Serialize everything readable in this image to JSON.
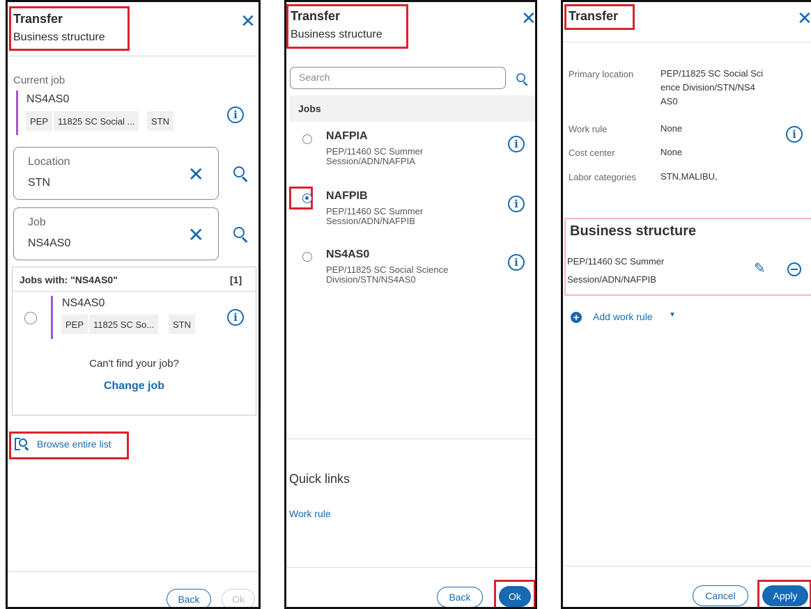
{
  "panel1": {
    "title": "Transfer",
    "subtitle": "Business structure",
    "current_job_label": "Current job",
    "current_job": {
      "name": "NS4AS0",
      "tags": [
        "PEP",
        "11825 SC Social ...",
        "STN"
      ]
    },
    "location_field": {
      "label": "Location",
      "value": "STN"
    },
    "job_field": {
      "label": "Job",
      "value": "NS4AS0"
    },
    "results_header": "Jobs with: \"NS4AS0\"",
    "results_count": "[1]",
    "result": {
      "name": "NS4AS0",
      "tags": [
        "PEP",
        "11825 SC So...",
        "STN"
      ]
    },
    "cant_find": "Can't find your job?",
    "change_job": "Change job",
    "browse_link": "Browse entire list",
    "back_button": "Back",
    "ok_button": "Ok"
  },
  "panel2": {
    "title": "Transfer",
    "subtitle": "Business structure",
    "search_placeholder": "Search",
    "jobs_header": "Jobs",
    "jobs": [
      {
        "name": "NAFPIA",
        "path_line1": "PEP/11460 SC Summer",
        "path_line2": "Session/ADN/NAFPIA",
        "selected": false
      },
      {
        "name": "NAFPIB",
        "path_line1": "PEP/11460 SC Summer",
        "path_line2": "Session/ADN/NAFPIB",
        "selected": true
      },
      {
        "name": "NS4AS0",
        "path_line1": "PEP/11825 SC Social Science",
        "path_line2": "Division/STN/NS4AS0",
        "selected": false
      }
    ],
    "quick_links_title": "Quick links",
    "quick_link": "Work rule",
    "back_button": "Back",
    "ok_button": "Ok"
  },
  "panel3": {
    "title": "Transfer",
    "primary_location_label": "Primary location",
    "primary_location_line1": "PEP/11825 SC Social Sci",
    "primary_location_line2": "ence Division/STN/NS4",
    "primary_location_line3": "AS0",
    "work_rule_label": "Work rule",
    "work_rule_value": "None",
    "cost_center_label": "Cost center",
    "cost_center_value": "None",
    "labor_categories_label": "Labor categories",
    "labor_categories_value": "STN,MALIBU,",
    "business_structure_title": "Business structure",
    "business_structure_line1": "PEP/11460 SC Summer",
    "business_structure_line2": "Session/ADN/NAFPIB",
    "add_work_rule": "Add work rule",
    "cancel_button": "Cancel",
    "apply_button": "Apply"
  },
  "colors": {
    "accent": "#1669b3",
    "highlight": "#d8242b",
    "job_bar": "#9b59d6"
  }
}
